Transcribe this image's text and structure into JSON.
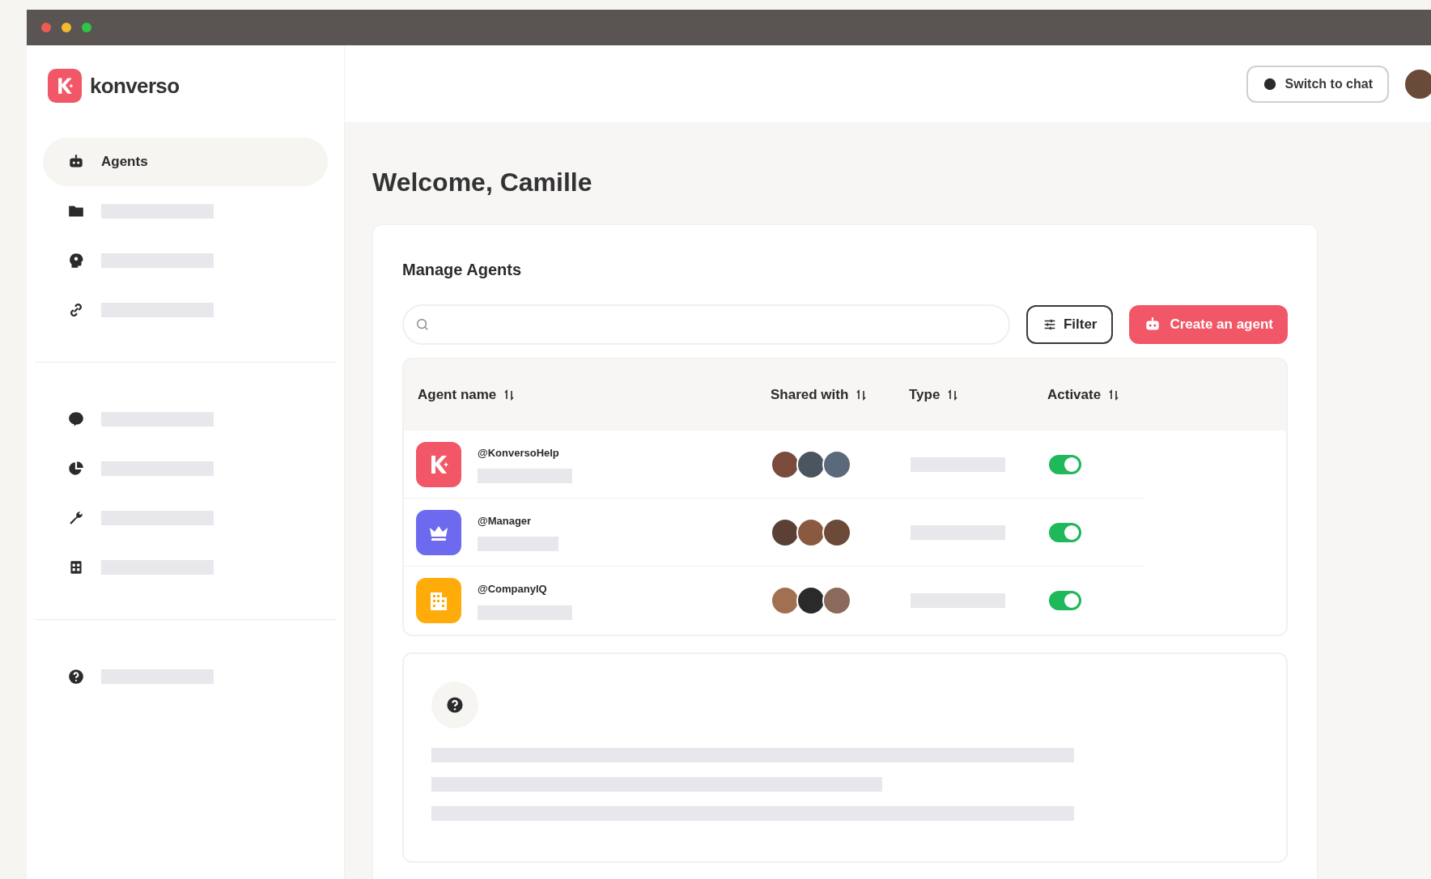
{
  "brand": {
    "name": "konverso"
  },
  "sidebar": {
    "groups": [
      [
        {
          "kind": "robot",
          "label": "Agents",
          "selected": true
        },
        {
          "kind": "folder",
          "selected": false
        },
        {
          "kind": "brain",
          "selected": false
        },
        {
          "kind": "link",
          "selected": false
        }
      ],
      [
        {
          "kind": "chat",
          "selected": false
        },
        {
          "kind": "pie",
          "selected": false
        },
        {
          "kind": "wrench",
          "selected": false
        },
        {
          "kind": "grid",
          "selected": false
        }
      ],
      [
        {
          "kind": "help",
          "selected": false
        }
      ]
    ]
  },
  "header": {
    "switch_button": "Switch to chat"
  },
  "welcome": "Welcome, Camille",
  "manage": {
    "title": "Manage Agents",
    "filter_button": "Filter",
    "create_button": "Create an agent",
    "columns": [
      "Agent name",
      "Shared with",
      "Type",
      "Activate"
    ],
    "rows": [
      {
        "name": "@KonversoHelp",
        "kind": "k",
        "color": "#f25767",
        "on": true
      },
      {
        "name": "@Manager",
        "kind": "crown",
        "color": "#6d6af0",
        "on": true
      },
      {
        "name": "@CompanyIQ",
        "kind": "building",
        "color": "#ffac0a",
        "on": true
      }
    ]
  }
}
